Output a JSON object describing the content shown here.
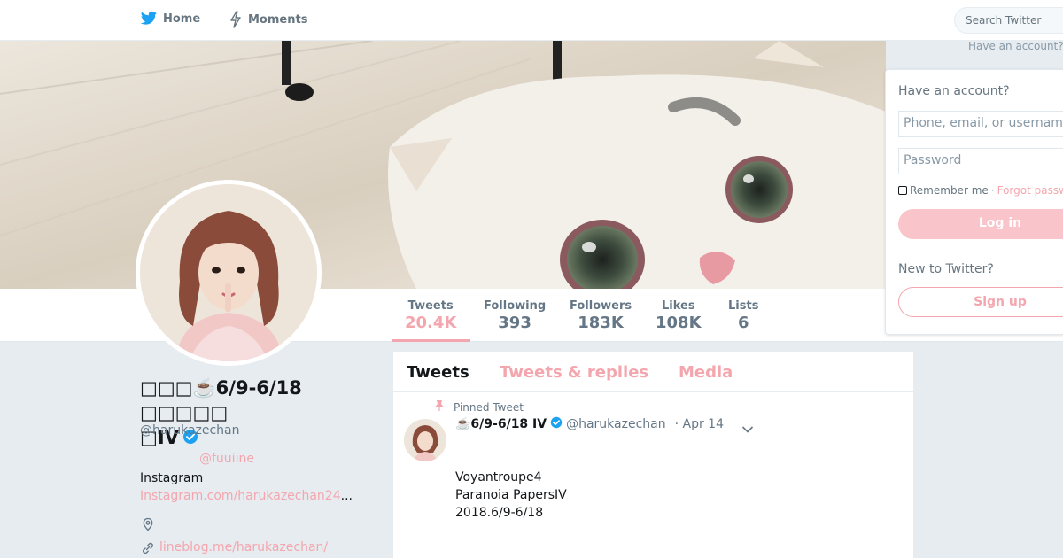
{
  "nav": {
    "home_label": "Home",
    "moments_label": "Moments",
    "search_placeholder": "Search Twitter",
    "have_account_link": "Have an account?"
  },
  "stats": [
    {
      "label": "Tweets",
      "value": "20.4K"
    },
    {
      "label": "Following",
      "value": "393"
    },
    {
      "label": "Followers",
      "value": "183K"
    },
    {
      "label": "Likes",
      "value": "108K"
    },
    {
      "label": "Lists",
      "value": "6"
    }
  ],
  "login": {
    "header": "Have an account?",
    "username_placeholder": "Phone, email, or username",
    "password_placeholder": "Password",
    "remember_label": "Remember me",
    "separator": "·",
    "forgot_label": "Forgot password?",
    "login_button": "Log in",
    "new_label": "New to Twitter?",
    "signup_button": "Sign up"
  },
  "profile": {
    "name_line1": "□□□☕️6/9-6/18 □□□□□",
    "name_line2": "□IV",
    "handle": "@harukazechan",
    "bio_mention": "@fuuiine",
    "bio_instagram_label": "Instagram",
    "bio_instagram_link": "Instagram.com/harukazechan24",
    "bio_ellipsis": "...",
    "url": "lineblog.me/harukazechan/"
  },
  "timeline": {
    "tabs": [
      "Tweets",
      "Tweets & replies",
      "Media"
    ],
    "pinned_label": "Pinned Tweet",
    "tweet": {
      "name": "☕️6/9-6/18 IV",
      "handle": "@harukazechan",
      "date": "· Apr 14",
      "lines": [
        "Voyantroupe4",
        "Paranoia PapersIV",
        "2018.6/9-6/18"
      ]
    }
  },
  "colors": {
    "accent": "#f4a6ae",
    "accent_light": "#f9c5cb",
    "verified": "#1da1f2",
    "text": "#14171a",
    "muted": "#657786"
  }
}
